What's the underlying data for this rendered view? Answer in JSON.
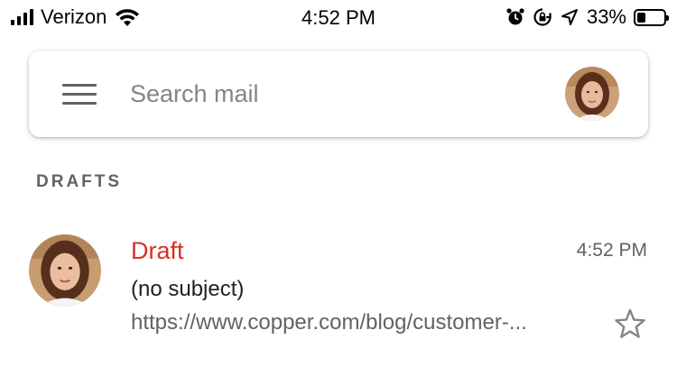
{
  "status_bar": {
    "carrier": "Verizon",
    "time": "4:52 PM",
    "battery_percent": "33%",
    "battery_level": 0.33,
    "icons": [
      "signal-bars-icon",
      "wifi-icon",
      "alarm-icon",
      "orientation-lock-icon",
      "location-arrow-icon",
      "battery-icon"
    ]
  },
  "search": {
    "placeholder": "Search mail",
    "value": ""
  },
  "header": {
    "menu_icon": "hamburger-menu-icon",
    "account_avatar": "avatar"
  },
  "section": {
    "label": "DRAFTS"
  },
  "messages": [
    {
      "sender": "Draft",
      "time": "4:52 PM",
      "subject": "(no subject)",
      "snippet": "https://www.copper.com/blog/customer-...",
      "starred": false
    }
  ],
  "colors": {
    "draft_label": "#d93025",
    "secondary_text": "#5f6368",
    "primary_text": "#202124"
  }
}
